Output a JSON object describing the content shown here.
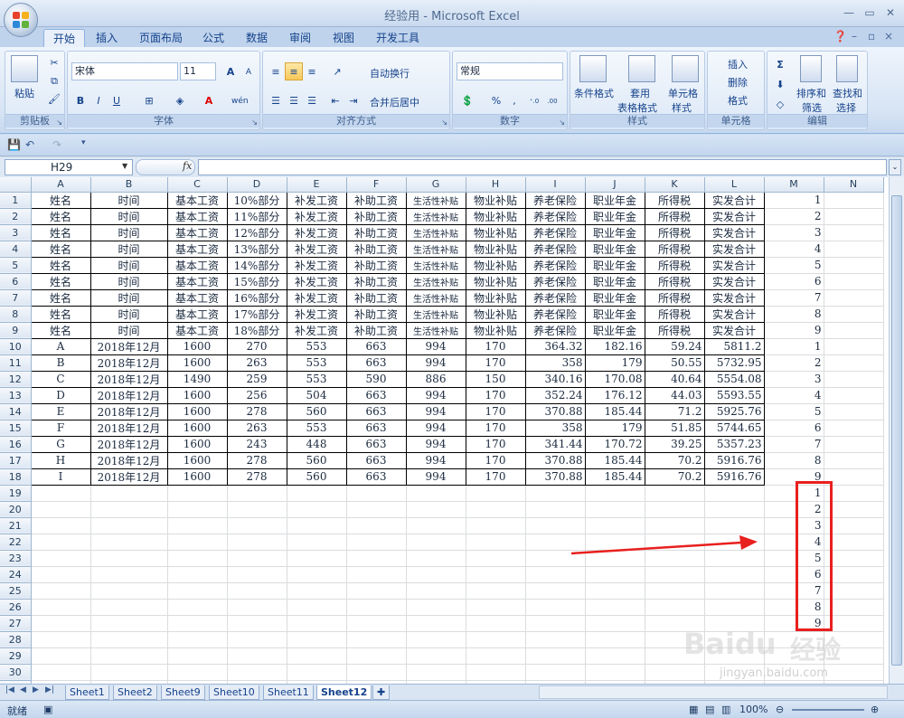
{
  "window": {
    "title": "经验用 - Microsoft Excel"
  },
  "ribbon_tabs": [
    "开始",
    "插入",
    "页面布局",
    "公式",
    "数据",
    "审阅",
    "视图",
    "开发工具"
  ],
  "ribbon": {
    "clipboard": {
      "paste": "粘贴",
      "label": "剪贴板"
    },
    "font": {
      "name": "宋体",
      "size": "11",
      "label": "字体",
      "bold": "B",
      "italic": "I",
      "underline": "U",
      "grow": "A",
      "shrink": "A",
      "color_a": "A",
      "wen": "wén"
    },
    "alignment": {
      "wrap": "自动换行",
      "merge": "合并后居中",
      "label": "对齐方式"
    },
    "number": {
      "format": "常规",
      "percent": "%",
      "comma": ",",
      "inc": "+.0 .00",
      "dec": ".00 →.0",
      "label": "数字"
    },
    "styles": {
      "cond": "条件格式",
      "table": "套用",
      "table2": "表格格式",
      "cell": "单元格",
      "cell2": "样式",
      "label": "样式"
    },
    "cells": {
      "insert": "插入",
      "delete": "删除",
      "format": "格式",
      "label": "单元格"
    },
    "editing": {
      "sort": "排序和",
      "sort2": "筛选",
      "find": "查找和",
      "find2": "选择",
      "sigma": "Σ",
      "label": "编辑"
    }
  },
  "namebox": "H29",
  "fx": "fx",
  "columns": [
    "A",
    "B",
    "C",
    "D",
    "E",
    "F",
    "G",
    "H",
    "I",
    "J",
    "K",
    "L",
    "M",
    "N"
  ],
  "header_row": [
    "姓名",
    "时间",
    "基本工资",
    "%部分",
    "补发工资",
    "补助工资",
    "生活性补贴",
    "物业补贴",
    "养老保险",
    "职业年金",
    "所得税",
    "实发合计"
  ],
  "header_pct": [
    "10",
    "11",
    "12",
    "13",
    "14",
    "15",
    "16",
    "17",
    "18"
  ],
  "data_rows": [
    [
      "A",
      "2018年12月",
      "1600",
      "270",
      "553",
      "663",
      "994",
      "170",
      "364.32",
      "182.16",
      "59.24",
      "5811.2"
    ],
    [
      "B",
      "2018年12月",
      "1600",
      "263",
      "553",
      "663",
      "994",
      "170",
      "358",
      "179",
      "50.55",
      "5732.95"
    ],
    [
      "C",
      "2018年12月",
      "1490",
      "259",
      "553",
      "590",
      "886",
      "150",
      "340.16",
      "170.08",
      "40.64",
      "5554.08"
    ],
    [
      "D",
      "2018年12月",
      "1600",
      "256",
      "504",
      "663",
      "994",
      "170",
      "352.24",
      "176.12",
      "44.03",
      "5593.55"
    ],
    [
      "E",
      "2018年12月",
      "1600",
      "278",
      "560",
      "663",
      "994",
      "170",
      "370.88",
      "185.44",
      "71.2",
      "5925.76"
    ],
    [
      "F",
      "2018年12月",
      "1600",
      "263",
      "553",
      "663",
      "994",
      "170",
      "358",
      "179",
      "51.85",
      "5744.65"
    ],
    [
      "G",
      "2018年12月",
      "1600",
      "243",
      "448",
      "663",
      "994",
      "170",
      "341.44",
      "170.72",
      "39.25",
      "5357.23"
    ],
    [
      "H",
      "2018年12月",
      "1600",
      "278",
      "560",
      "663",
      "994",
      "170",
      "370.88",
      "185.44",
      "70.2",
      "5916.76"
    ],
    [
      "I",
      "2018年12月",
      "1600",
      "278",
      "560",
      "663",
      "994",
      "170",
      "370.88",
      "185.44",
      "70.2",
      "5916.76"
    ]
  ],
  "m_values": [
    "1",
    "2",
    "3",
    "4",
    "5",
    "6",
    "7",
    "8",
    "9",
    "1",
    "2",
    "3",
    "4",
    "5",
    "6",
    "7",
    "8",
    "9",
    "1",
    "2",
    "3",
    "4",
    "5",
    "6",
    "7",
    "8",
    "9"
  ],
  "sheet_tabs": [
    "Sheet1",
    "Sheet2",
    "Sheet9",
    "Sheet10",
    "Sheet11",
    "Sheet12"
  ],
  "status": {
    "ready": "就绪",
    "zoom": "100%"
  },
  "watermark": {
    "brand": "Baidu",
    "jingyan": "经验",
    "url": "jingyan.baidu.com"
  },
  "colors": {
    "annotation": "#e8201e",
    "ribbon": "#dbe7f5"
  }
}
